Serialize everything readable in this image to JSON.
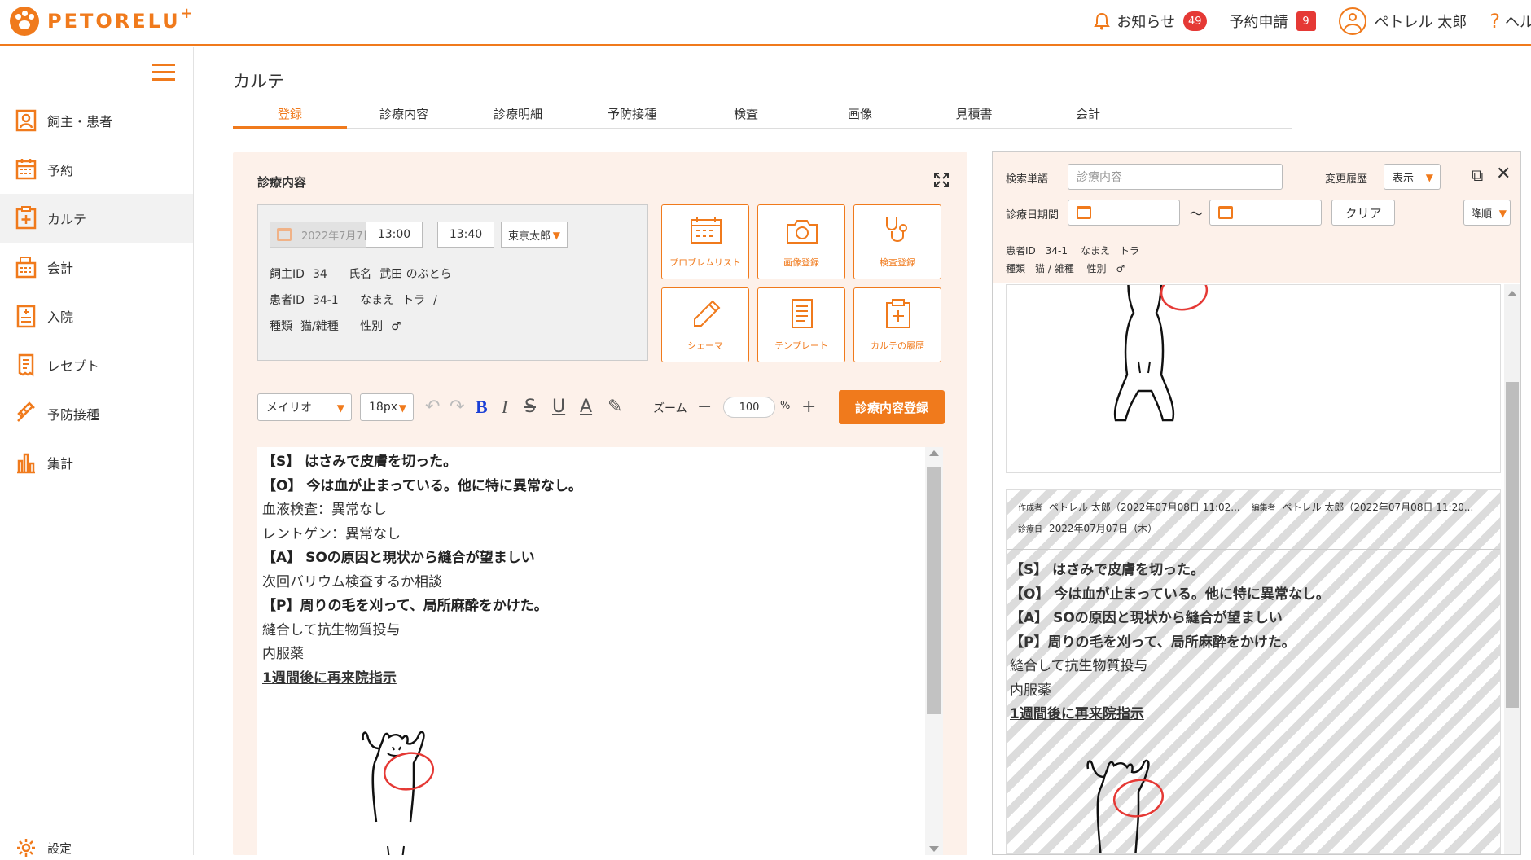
{
  "app": {
    "brand": "PETORELU",
    "brand_plus": "+"
  },
  "header": {
    "notifications_label": "お知らせ",
    "notifications_count": "49",
    "reservations_label": "予約申請",
    "reservations_count": "9",
    "user_name": "ペトレル 太郎",
    "help_label": "ヘル"
  },
  "sidebar": {
    "items": [
      {
        "label": "飼主・患者",
        "icon": "owner-patient-icon"
      },
      {
        "label": "予約",
        "icon": "calendar-icon"
      },
      {
        "label": "カルテ",
        "icon": "medical-chart-icon",
        "active": true
      },
      {
        "label": "会計",
        "icon": "register-icon"
      },
      {
        "label": "入院",
        "icon": "hospitalization-icon"
      },
      {
        "label": "レセプト",
        "icon": "receipt-icon"
      },
      {
        "label": "予防接種",
        "icon": "syringe-icon"
      },
      {
        "label": "集計",
        "icon": "bar-chart-icon"
      }
    ],
    "settings_label": "設定"
  },
  "page": {
    "title": "カルテ"
  },
  "tabs": [
    "登録",
    "診療内容",
    "診療明細",
    "予防接種",
    "検査",
    "画像",
    "見積書",
    "会計"
  ],
  "active_tab": "登録",
  "record": {
    "section_title": "診療内容",
    "date": "2022年7月7日",
    "time_start": "13:00",
    "time_end": "13:40",
    "tilde": "〜",
    "doctor": "東京太郎",
    "owner_id_label": "飼主ID",
    "owner_id": "34",
    "owner_name_label": "氏名",
    "owner_name": "武田 のぶとら",
    "patient_id_label": "患者ID",
    "patient_id": "34-1",
    "patient_name_label": "なまえ",
    "patient_name": "トラ",
    "patient_sep": "/",
    "species_label": "種類",
    "species": "猫/雑種",
    "sex_label": "性別",
    "sex": "♂"
  },
  "actions": [
    {
      "label": "プロブレムリスト",
      "icon": "calendar-grid-icon"
    },
    {
      "label": "画像登録",
      "icon": "camera-icon"
    },
    {
      "label": "検査登録",
      "icon": "stethoscope-icon"
    },
    {
      "label": "シェーマ",
      "icon": "pencil-icon"
    },
    {
      "label": "テンプレート",
      "icon": "document-icon"
    },
    {
      "label": "カルテの履歴",
      "icon": "clipboard-plus-icon"
    }
  ],
  "toolbar": {
    "font": "メイリオ",
    "size": "18px",
    "zoom_label": "ズーム",
    "zoom_value": "100",
    "zoom_unit": "%",
    "submit_label": "診療内容登録"
  },
  "editor": {
    "lines": [
      {
        "text": "【S】 はさみで皮膚を切った。",
        "style": "b"
      },
      {
        "text": "【O】 今は血が止まっている。他に特に異常なし。",
        "style": "b"
      },
      {
        "text": "血液検査：異常なし",
        "style": ""
      },
      {
        "text": "レントゲン：異常なし",
        "style": ""
      },
      {
        "text": "【A】 SOの原因と現状から縫合が望ましい",
        "style": "b"
      },
      {
        "text": "次回バリウム検査するか相談",
        "style": ""
      },
      {
        "text": "【P】周りの毛を刈って、局所麻酔をかけた。",
        "style": "b"
      },
      {
        "text": "縫合して抗生物質投与",
        "style": ""
      },
      {
        "text": "内服薬",
        "style": ""
      },
      {
        "text": "1週間後に再来院指示",
        "style": "u"
      }
    ]
  },
  "history_panel": {
    "search_label": "検索単語",
    "search_placeholder": "診療内容",
    "history_label": "変更履歴",
    "history_value": "表示",
    "date_range_label": "診療日期間",
    "range_sep": "〜",
    "clear_label": "クリア",
    "order_value": "降順",
    "patient_id_label": "患者ID",
    "patient_id": "34-1",
    "patient_name_label": "なまえ",
    "patient_name": "トラ",
    "species_label": "種類",
    "species": "猫 / 雑種",
    "sex_label": "性別",
    "sex": "♂",
    "entry": {
      "author_label": "作成者",
      "author": "ペトレル 太郎（2022年07月08日 11:02...",
      "editor_label": "編集者",
      "editor": "ペトレル 太郎（2022年07月08日 11:20...",
      "date_label": "診療日",
      "date": "2022年07月07日（木）",
      "lines": [
        {
          "text": "【S】 はさみで皮膚を切った。",
          "style": "b"
        },
        {
          "text": "【O】 今は血が止まっている。他に特に異常なし。",
          "style": "b"
        },
        {
          "text": "【A】 SOの原因と現状から縫合が望ましい",
          "style": "b"
        },
        {
          "text": "【P】周りの毛を刈って、局所麻酔をかけた。",
          "style": "b"
        },
        {
          "text": "縫合して抗生物質投与",
          "style": ""
        },
        {
          "text": "内服薬",
          "style": ""
        },
        {
          "text": "1週間後に再来院指示",
          "style": "u"
        }
      ]
    }
  },
  "colors": {
    "accent": "#f07a1c",
    "badge": "#e53935",
    "panel_bg": "#fdf1ea",
    "schema_mark": "#e53935"
  }
}
